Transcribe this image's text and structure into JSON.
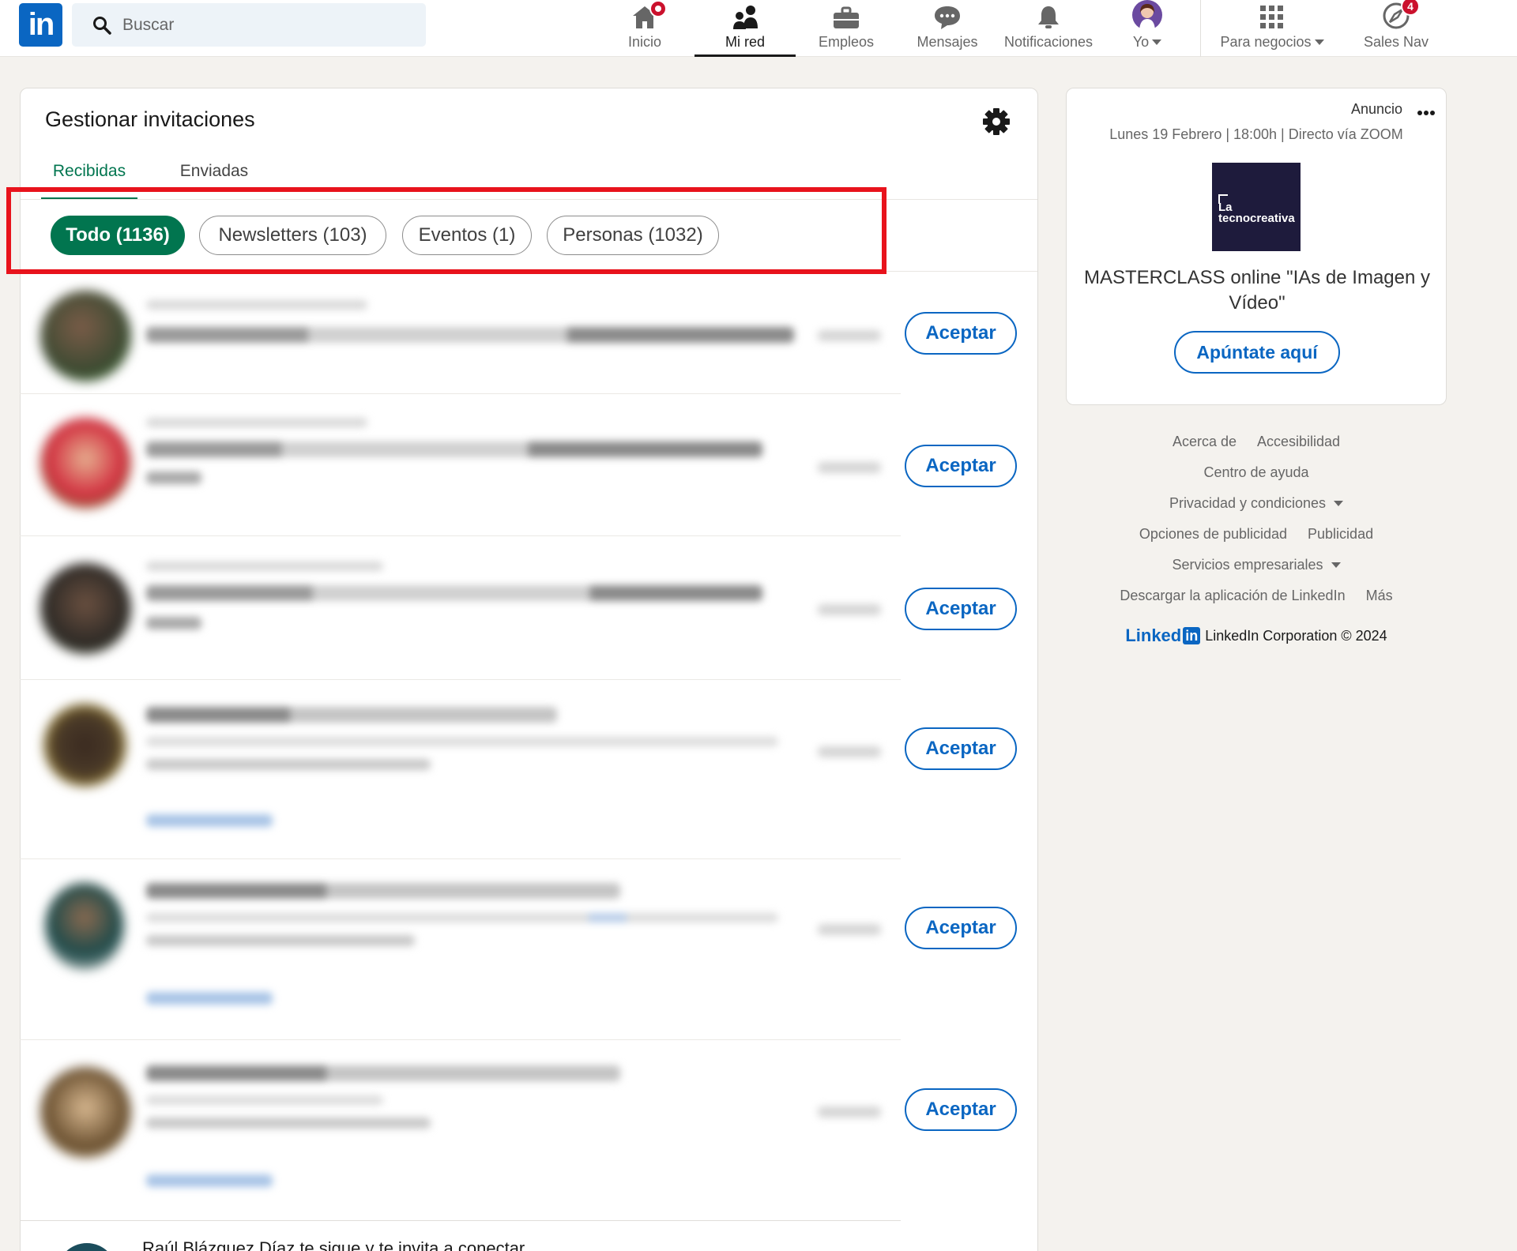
{
  "search": {
    "placeholder": "Buscar"
  },
  "nav": {
    "inicio": "Inicio",
    "mired": "Mi red",
    "empleos": "Empleos",
    "mensajes": "Mensajes",
    "notificaciones": "Notificaciones",
    "yo": "Yo",
    "negocios": "Para negocios",
    "salesnav": "Sales Nav",
    "salesnav_badge": "4"
  },
  "invitations": {
    "title": "Gestionar invitaciones",
    "tabs": [
      "Recibidas",
      "Enviadas"
    ],
    "filters": [
      "Todo (1136)",
      "Newsletters (103)",
      "Eventos (1)",
      "Personas (1032)"
    ],
    "accept_label": "Aceptar",
    "last_row_text": "Raúl Blázquez Díaz  te sigue y te invita a conectar"
  },
  "ad": {
    "label": "Anuncio",
    "subtitle": "Lunes 19 Febrero | 18:00h | Directo vía ZOOM",
    "logo_line1": "La",
    "logo_line2": "tecnocreativa",
    "title": "MASTERCLASS online \"IAs de Imagen y Vídeo\"",
    "button": "Apúntate aquí"
  },
  "footer": {
    "links": [
      "Acerca de",
      "Accesibilidad",
      "Centro de ayuda",
      "Privacidad y condiciones",
      "Opciones de publicidad",
      "Publicidad",
      "Servicios empresariales",
      "Descargar la aplicación de LinkedIn",
      "Más"
    ],
    "brand": "Linked",
    "brand_box": "in",
    "copyright": "LinkedIn Corporation © 2024"
  },
  "colors": {
    "brand_blue": "#0a66c2",
    "active_green": "#01754f",
    "highlight_red": "#e8131c",
    "badge_red": "#cb112d"
  }
}
